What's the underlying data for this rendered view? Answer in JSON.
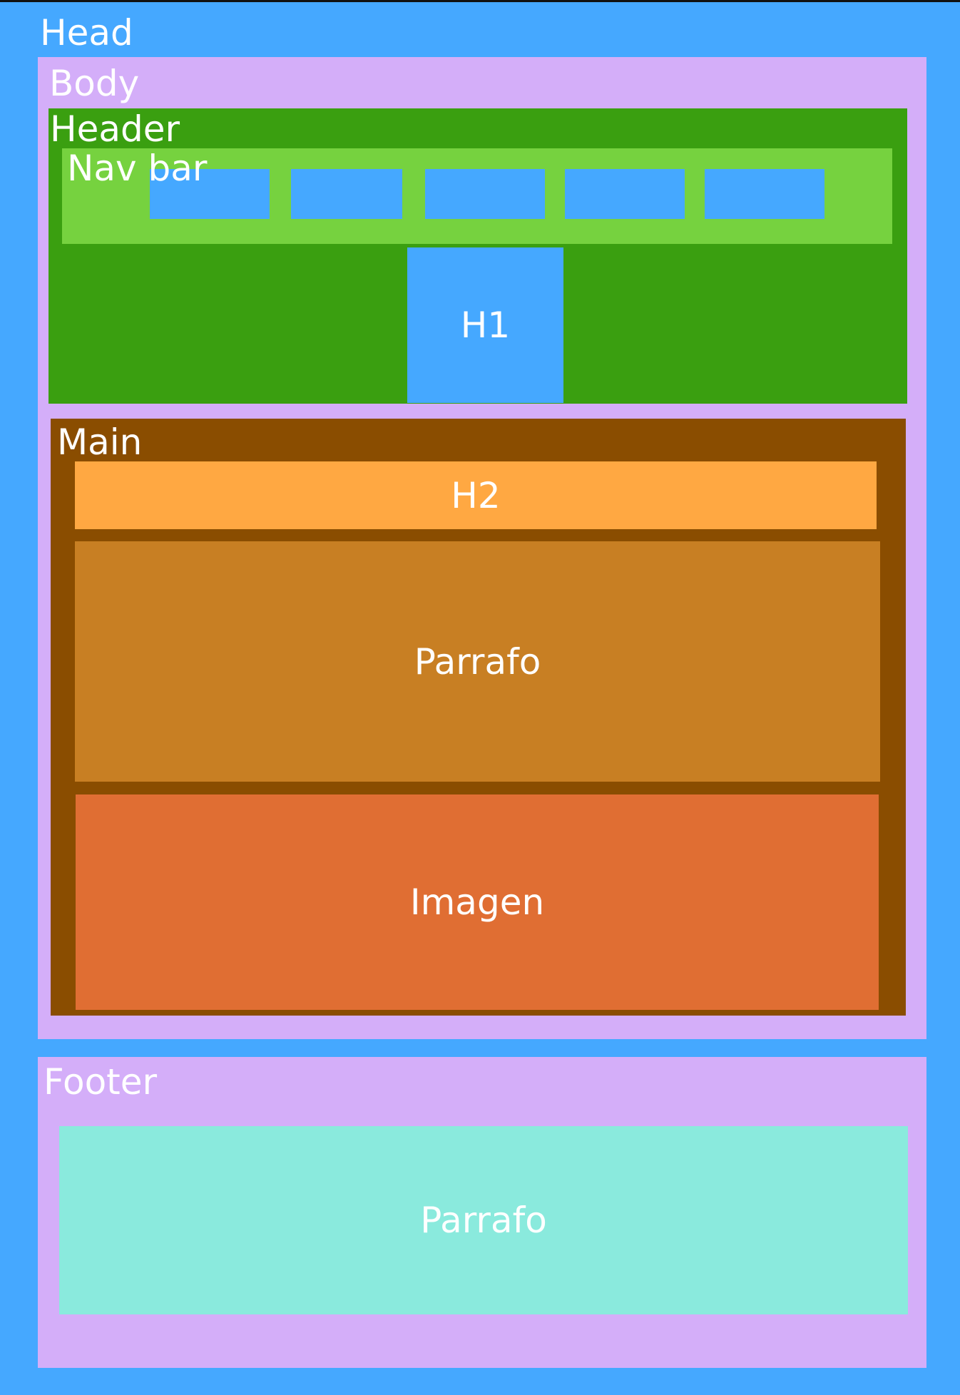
{
  "colors": {
    "head": "#45a8ff",
    "body": "#d4aef9",
    "header": "#3a9f10",
    "navbar": "#76d23f",
    "nav_item": "#45a8ff",
    "h1": "#45a8ff",
    "main": "#8a4d00",
    "h2": "#ffa842",
    "parrafo": "#c87f23",
    "imagen": "#e06e33",
    "footer": "#d4aef9",
    "footer_parrafo": "#8aeadd",
    "text": "#ffffff"
  },
  "head": {
    "label": "Head"
  },
  "body": {
    "label": "Body"
  },
  "header": {
    "label": "Header"
  },
  "navbar": {
    "label": "Nav bar",
    "item_count": 5
  },
  "h1": {
    "label": "H1"
  },
  "main": {
    "label": "Main"
  },
  "h2": {
    "label": "H2"
  },
  "paragraph": {
    "label": "Parrafo"
  },
  "image": {
    "label": "Imagen"
  },
  "footer": {
    "label": "Footer"
  },
  "footer_paragraph": {
    "label": "Parrafo"
  }
}
